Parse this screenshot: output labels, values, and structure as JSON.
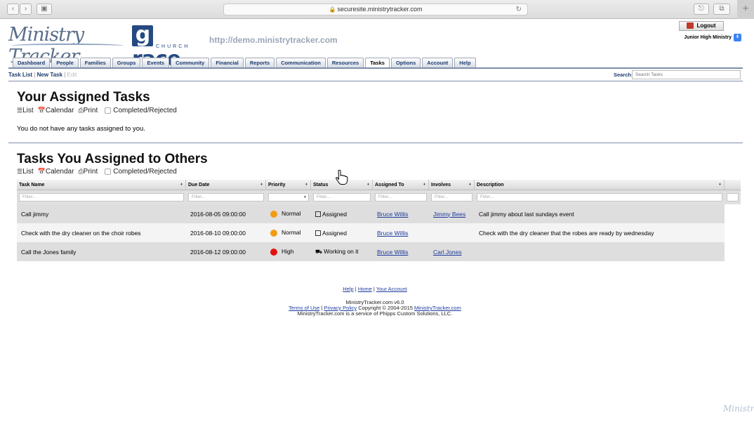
{
  "browser": {
    "url": "securesite.ministrytracker.com",
    "back_icon": "chevron-left-icon",
    "forward_icon": "chevron-right-icon"
  },
  "brand": {
    "ministry_tracker_logo": "Ministry Tracker",
    "church_logo": "grace",
    "church_logo_sub": "CHURCH",
    "site_url": "http://demo.ministrytracker.com"
  },
  "account": {
    "logout_label": "Logout",
    "ministry_selected": "Junior High Ministry"
  },
  "nav": {
    "tabs": [
      {
        "label": "Dashboard"
      },
      {
        "label": "People"
      },
      {
        "label": "Families"
      },
      {
        "label": "Groups"
      },
      {
        "label": "Events"
      },
      {
        "label": "Community"
      },
      {
        "label": "Financial"
      },
      {
        "label": "Reports"
      },
      {
        "label": "Communication"
      },
      {
        "label": "Resources"
      },
      {
        "label": "Tasks",
        "active": true
      },
      {
        "label": "Options"
      },
      {
        "label": "Account"
      },
      {
        "label": "Help"
      }
    ]
  },
  "subnav": {
    "task_list": "Task List",
    "sep1": "|",
    "new_task": "New Task",
    "sep2": "|",
    "edit": "Edit"
  },
  "search": {
    "label": "Search:",
    "placeholder": "Search Tasks"
  },
  "assigned": {
    "title": "Your Assigned Tasks",
    "list": "List",
    "calendar": "Calendar",
    "print": "Print",
    "completed": "Completed/Rejected",
    "empty_message": "You do not have any tasks assigned to you."
  },
  "others": {
    "title": "Tasks You Assigned to Others",
    "list": "List",
    "calendar": "Calendar",
    "print": "Print",
    "completed": "Completed/Rejected",
    "columns": [
      "Task Name",
      "Due Date",
      "Priority",
      "Status",
      "Assigned To",
      "Involves",
      "Description"
    ],
    "filter_placeholder": "Filter...",
    "rows": [
      {
        "task": "Call jimmy",
        "due": "2016-08-05 09:00:00",
        "priority": "Normal",
        "priority_color": "#f39c12",
        "status": "Assigned",
        "status_icon": "checkbox-icon",
        "assigned_to": "Bruce Willis",
        "involves": "Jimmy Bees",
        "description": "Call jimmy about last sundays event"
      },
      {
        "task": "Check with the dry cleaner on the choir robes",
        "due": "2016-08-10 09:00:00",
        "priority": "Normal",
        "priority_color": "#f39c12",
        "status": "Assigned",
        "status_icon": "checkbox-icon",
        "assigned_to": "Bruce Willis",
        "involves": "",
        "description": "Check with the dry cleaner that the robes are ready by wednesday"
      },
      {
        "task": "Call the Jones family",
        "due": "2016-08-12 09:00:00",
        "priority": "High",
        "priority_color": "#e3120b",
        "status": "Working on it",
        "status_icon": "truck-icon",
        "assigned_to": "Bruce Willis",
        "involves": "Carl Jones",
        "description": ""
      }
    ]
  },
  "footer": {
    "help": "Help",
    "home": "Home",
    "your_account": "Your Account",
    "version": "MinistryTracker.com v6.0",
    "terms": "Terms of Use",
    "privacy": "Privacy Policy",
    "copyright": "Copyright © 2004-2015",
    "copyright_link": "MinistryTracker.com",
    "service": "MinistryTracker.com is a service of Phipps Custom Solutions, LLC."
  },
  "watermark": "Ministry"
}
